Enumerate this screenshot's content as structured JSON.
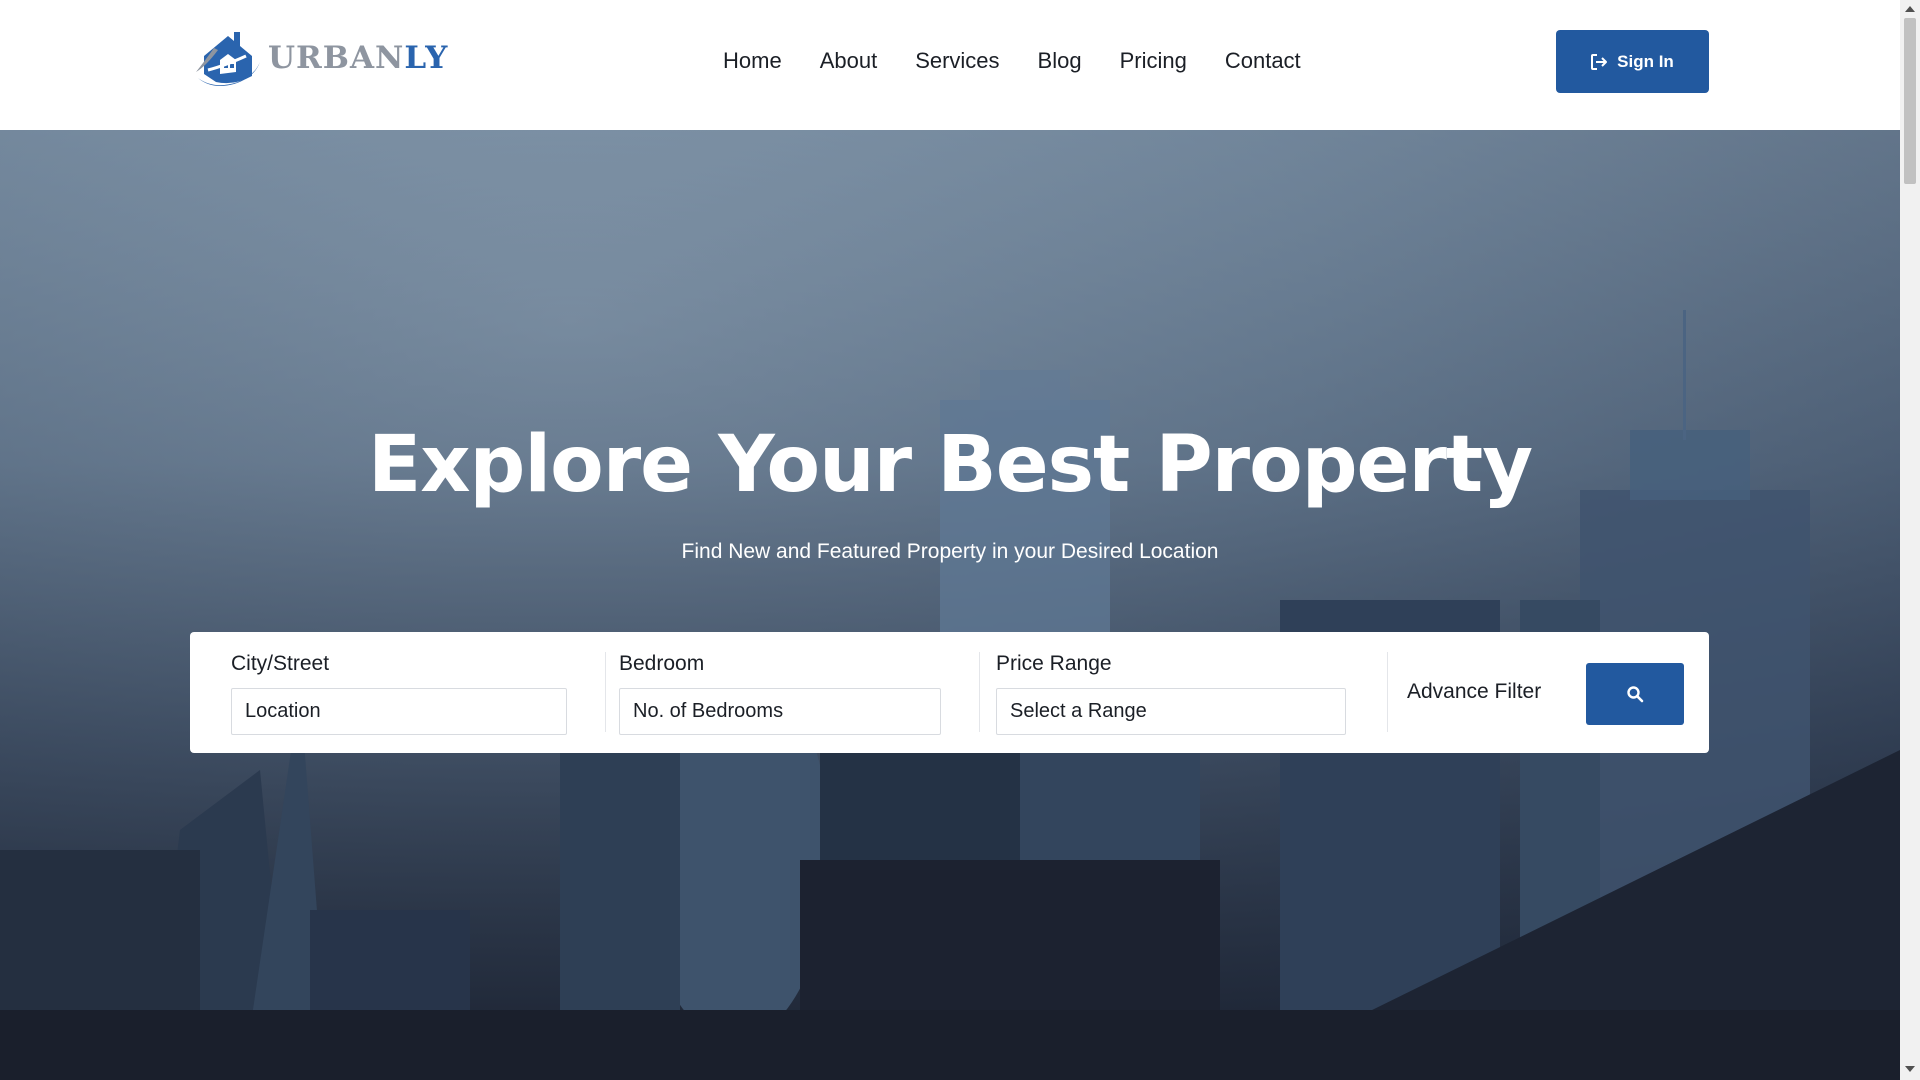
{
  "header": {
    "logo": {
      "text_part1": "URBAN",
      "text_part2": "LY",
      "icon": "house-logo-icon"
    },
    "nav": [
      {
        "label": "Home"
      },
      {
        "label": "About"
      },
      {
        "label": "Services"
      },
      {
        "label": "Blog"
      },
      {
        "label": "Pricing"
      },
      {
        "label": "Contact"
      }
    ],
    "sign_in": {
      "label": "Sign In",
      "icon": "sign-in-icon"
    }
  },
  "hero": {
    "title": "Explore Your Best Property",
    "subtitle": "Find New and Featured Property in your Desired Location"
  },
  "search": {
    "city": {
      "label": "City/Street",
      "value": "Location"
    },
    "bedroom": {
      "label": "Bedroom",
      "value": "No. of Bedrooms"
    },
    "price": {
      "label": "Price Range",
      "value": "Select a Range"
    },
    "advance_filter": "Advance Filter",
    "search_icon": "search-icon"
  },
  "colors": {
    "brand_blue": "#22599f",
    "logo_gray": "#8e95a0",
    "header_bg": "#ffffff"
  }
}
